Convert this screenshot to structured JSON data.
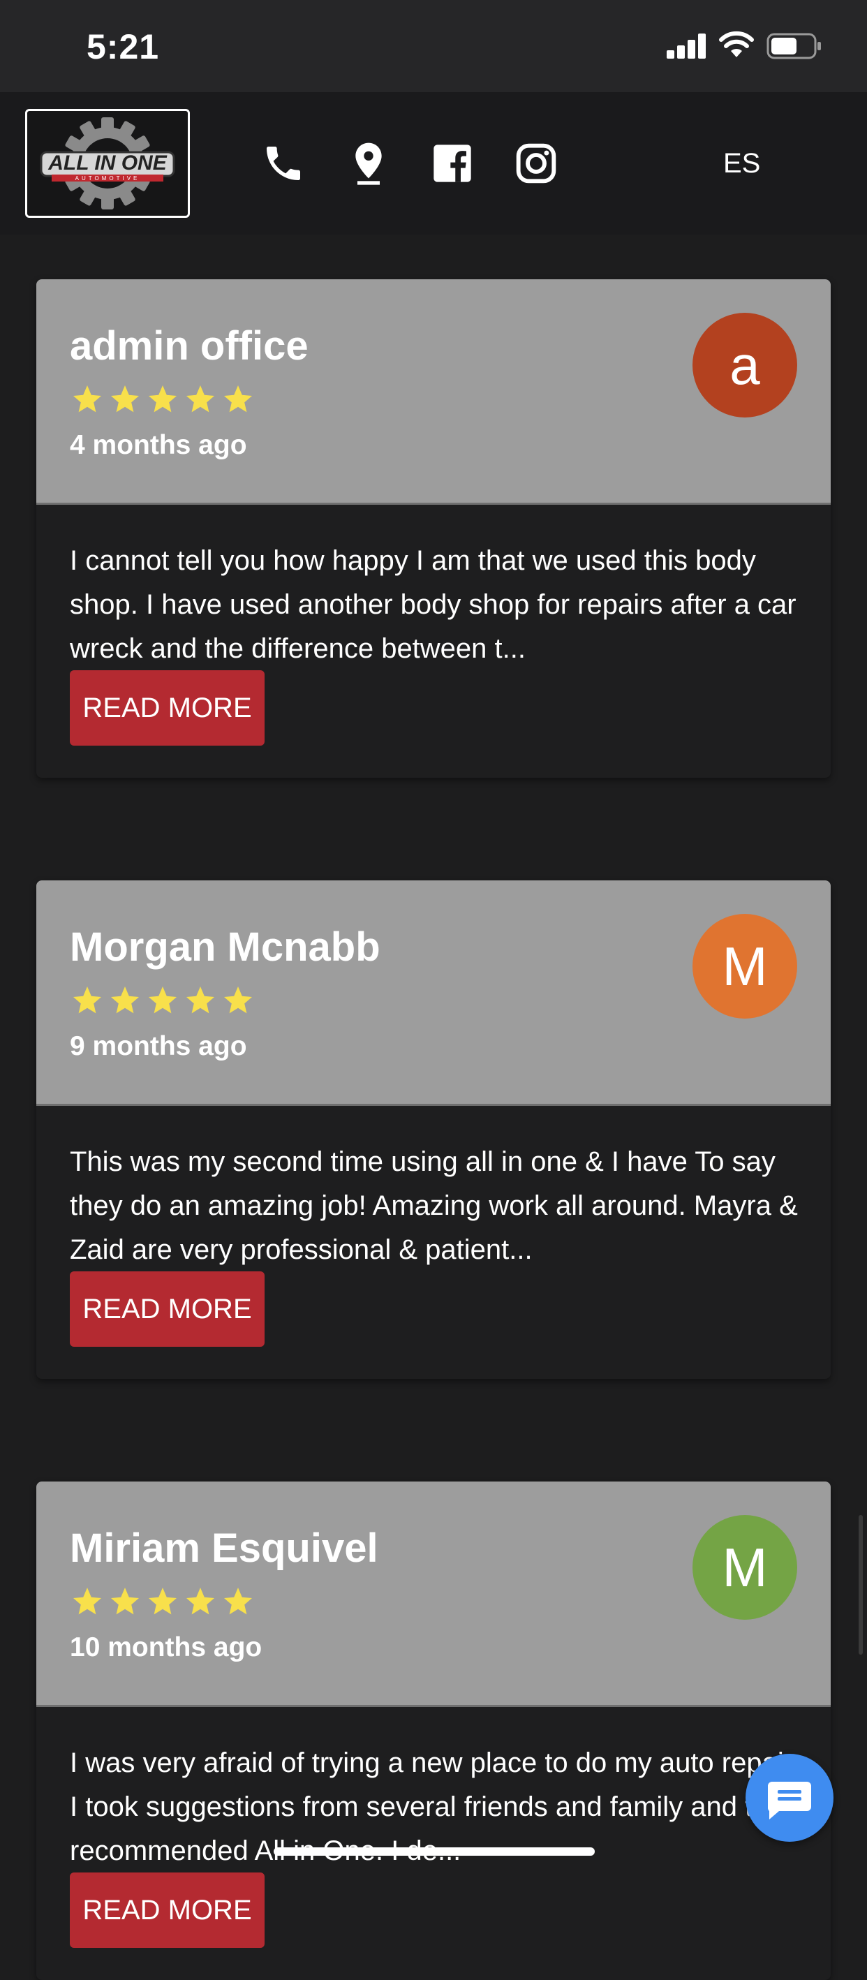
{
  "status_bar": {
    "time": "5:21"
  },
  "header": {
    "logo": {
      "text": "ALL IN ONE",
      "subtext": "AUTOMOTIVE"
    },
    "icons": [
      "phone-icon",
      "location-pin-icon",
      "facebook-icon",
      "instagram-icon"
    ],
    "language_toggle": "ES"
  },
  "reviews": [
    {
      "name": "admin office",
      "rating": 5,
      "time_ago": "4 months ago",
      "avatar_letter": "a",
      "avatar_color": "#b3411f",
      "text": "I cannot tell you how happy I am that we used this body shop. I have used another body shop for repairs after a car wreck and the difference between t...",
      "button": "READ MORE"
    },
    {
      "name": "Morgan Mcnabb",
      "rating": 5,
      "time_ago": "9 months ago",
      "avatar_letter": "M",
      "avatar_color": "#e07430",
      "text": "This was my second time using all in one & I have To say they do an amazing job! Amazing work all around. Mayra & Zaid are very professional & patient...",
      "button": "READ MORE"
    },
    {
      "name": "Miriam Esquivel",
      "rating": 5,
      "time_ago": "10 months ago",
      "avatar_letter": "M",
      "avatar_color": "#74a445",
      "text": "I was very afraid of trying a new place to do my auto repair. I took suggestions from several friends and family and they recommended All in One. I de...",
      "button": "READ MORE"
    }
  ],
  "colors": {
    "background": "#1d1d1e",
    "card_header": "#9d9d9d",
    "button": "#b42a31",
    "star": "#f8e04b",
    "chat_button": "#3f8cf0"
  }
}
